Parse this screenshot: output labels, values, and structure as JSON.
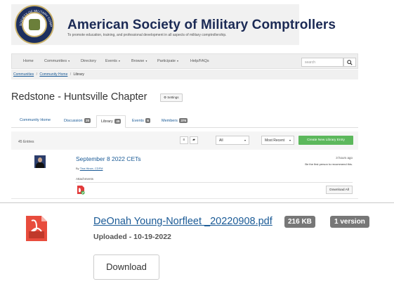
{
  "header": {
    "title": "American Society of Military Comptrollers",
    "tagline": "To promote education, training, and professional development in all aspects of military comptrollership.",
    "seal_text": "SOCIETY OF MILITARY COMPTROLLERS"
  },
  "nav": {
    "items": [
      {
        "label": "Home",
        "dropdown": false
      },
      {
        "label": "Communities",
        "dropdown": true
      },
      {
        "label": "Directory",
        "dropdown": false
      },
      {
        "label": "Events",
        "dropdown": true
      },
      {
        "label": "Browse",
        "dropdown": true
      },
      {
        "label": "Participate",
        "dropdown": true
      },
      {
        "label": "Help/FAQs",
        "dropdown": false
      }
    ],
    "search_placeholder": "search",
    "search_icon": "magnifier-icon",
    "caret": "▾"
  },
  "breadcrumb": {
    "items": [
      "Communities",
      "Community Home",
      "Library"
    ],
    "separator": "/"
  },
  "page": {
    "title": "Redstone - Huntsville Chapter",
    "settings_label": "⚙ Settings"
  },
  "tabs": [
    {
      "label": "Community Home",
      "badge": ""
    },
    {
      "label": "Discussion",
      "badge": "20"
    },
    {
      "label": "Library",
      "badge": "45"
    },
    {
      "label": "Events",
      "badge": "6"
    },
    {
      "label": "Members",
      "badge": "376"
    }
  ],
  "toolbar": {
    "entries": "45 Entries",
    "filter_value": "All",
    "sort_value": "Most Recent",
    "create_label": "Create New Library Entry",
    "create_color": "#5cb85c",
    "caret": "▾",
    "list_view_icon": "≡",
    "folder_view_icon": "▰"
  },
  "entry": {
    "title": "September 8 2022 CETs",
    "by_prefix": "By",
    "author": "Tina Hinze, CDFM",
    "time": "3 hours ago",
    "recommend": "Be the first person to recommend this.",
    "attachments_label": "Attachments",
    "download_all": "Download All"
  },
  "document": {
    "name": "DeOnah Young-Norfleet _20220908.pdf",
    "size": "216 KB",
    "versions": "1 version",
    "uploaded": "Uploaded - 10-19-2022",
    "download_label": "Download"
  },
  "colors": {
    "link": "#1a5a96",
    "badge": "#777777",
    "brand": "#1b2a55"
  }
}
